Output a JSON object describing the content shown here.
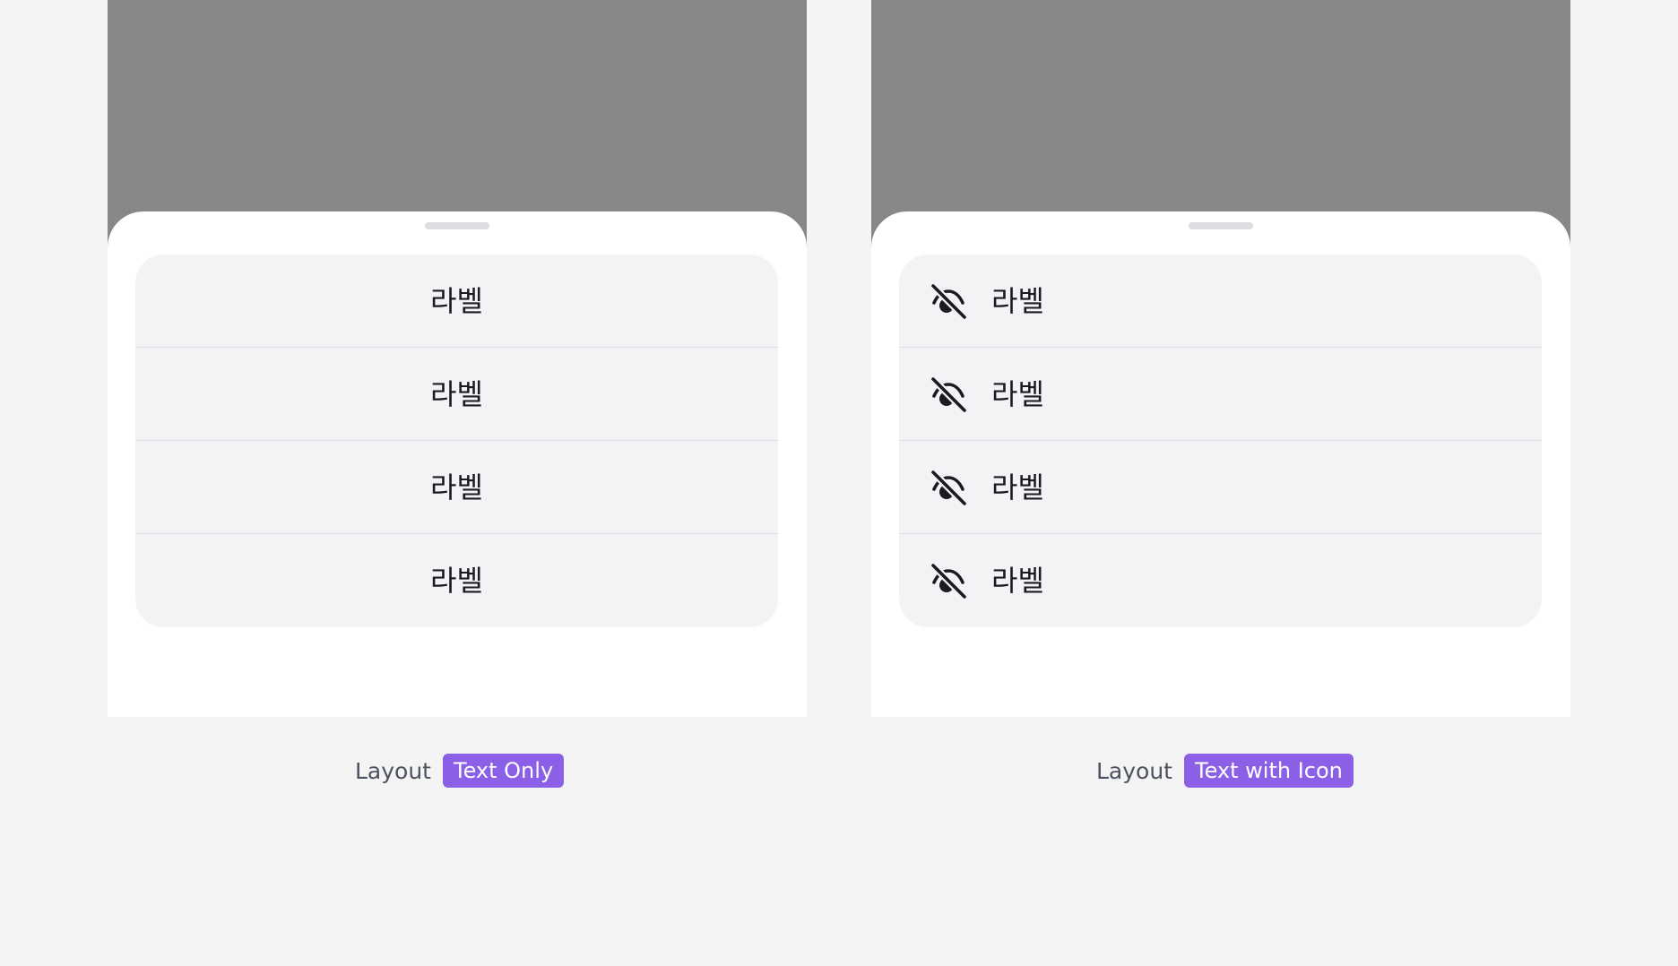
{
  "left_example": {
    "items": [
      {
        "label": "라벨"
      },
      {
        "label": "라벨"
      },
      {
        "label": "라벨"
      },
      {
        "label": "라벨"
      }
    ],
    "caption_label": "Layout",
    "caption_value": "Text Only"
  },
  "right_example": {
    "items": [
      {
        "label": "라벨",
        "icon": "eye-slash-icon"
      },
      {
        "label": "라벨",
        "icon": "eye-slash-icon"
      },
      {
        "label": "라벨",
        "icon": "eye-slash-icon"
      },
      {
        "label": "라벨",
        "icon": "eye-slash-icon"
      }
    ],
    "caption_label": "Layout",
    "caption_value": "Text with Icon"
  },
  "colors": {
    "backdrop": "#888888",
    "sheet": "#ffffff",
    "list_background": "#f2f3f5",
    "divider": "#dcdde1",
    "text": "#1b1b1f",
    "badge": "#8b5fe6",
    "page_background": "#f4f4f5"
  }
}
